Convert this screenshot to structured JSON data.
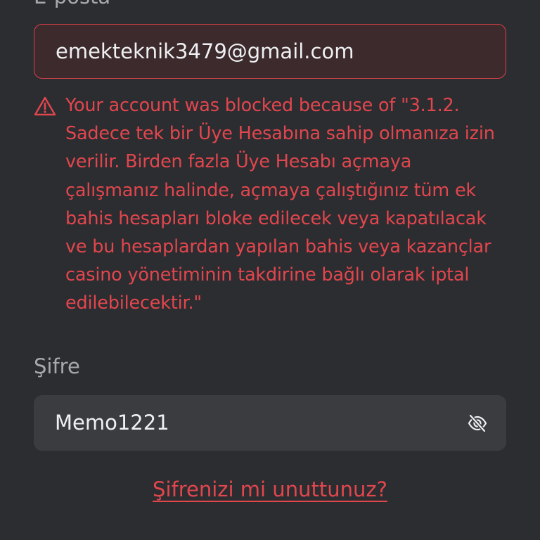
{
  "form": {
    "email_label": "E-posta",
    "email_value": "emekteknik3479@gmail.com",
    "error_message": "Your account was blocked because of \"3.1.2.\nSadece tek bir Üye Hesabına sahip olmanıza izin\nverilir. Birden fazla Üye Hesabı açmaya\nçalışmanız halinde, açmaya çalıştığınız tüm ek\nbahis hesapları bloke edilecek veya kapatılacak\nve bu hesaplardan yapılan bahis veya kazançlar\ncasino yönetiminin takdirine bağlı olarak iptal\nedilebilecektir.\"",
    "password_label": "Şifre",
    "password_value": "Memo1221",
    "forgot_link": "Şifrenizi mi unuttunuz?"
  },
  "icons": {
    "warning": "warning-triangle-icon",
    "password_toggle": "eye-off-icon"
  },
  "colors": {
    "background": "#2b2d31",
    "error": "#e2464d",
    "error_field_bg": "#3c2a2d",
    "field_bg": "#3a3c40",
    "label": "#a7a9ad",
    "text": "#eef0f2"
  }
}
